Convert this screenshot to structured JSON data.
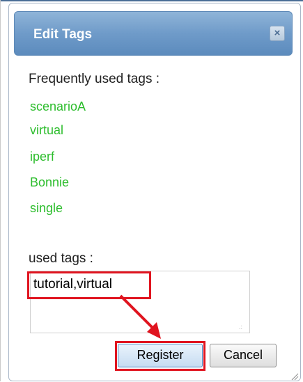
{
  "dialog": {
    "title": "Edit Tags",
    "close_glyph": "×",
    "frequent_label": "Frequently used tags :",
    "frequent_tags": [
      "scenarioA",
      "virtual",
      "iperf",
      "Bonnie",
      "single"
    ],
    "used_label": "used tags :",
    "used_tags_value": "tutorial,virtual",
    "register_label": "Register",
    "cancel_label": "Cancel"
  },
  "colors": {
    "titlebar": "#6f9bc9",
    "tag_link": "#2dbd2d",
    "highlight": "#e0141f"
  },
  "icons": {
    "close": "close-icon",
    "resize": "resize-grip-icon",
    "annotation": "arrow-annotation"
  }
}
